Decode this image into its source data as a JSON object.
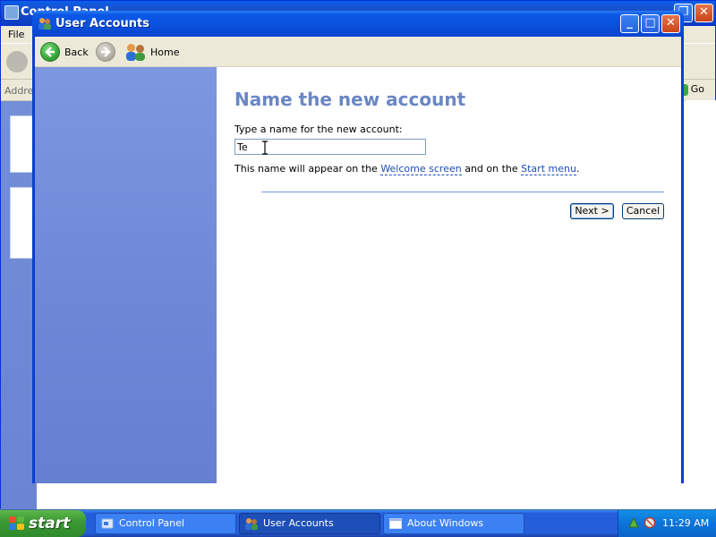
{
  "background_window": {
    "title": "Control Panel",
    "menu": "File",
    "address_label": "Address",
    "go_label": "Go"
  },
  "dialog": {
    "title": "User Accounts",
    "toolbar": {
      "back_label": "Back",
      "forward_label": "",
      "home_label": "Home"
    },
    "page_title": "Name the new account",
    "name_label": "Type a name for the new account:",
    "name_value": "Te",
    "hint_prefix": "This name will appear on the ",
    "hint_link1": "Welcome screen",
    "hint_middle": " and on the ",
    "hint_link2": "Start menu",
    "hint_suffix": ".",
    "next_label": "Next >",
    "cancel_label": "Cancel"
  },
  "taskbar": {
    "start_label": "start",
    "tasks": [
      {
        "label": "Control Panel",
        "icon": "control-panel-icon"
      },
      {
        "label": "User Accounts",
        "icon": "user-accounts-icon"
      },
      {
        "label": "About Windows",
        "icon": "window-icon"
      }
    ],
    "clock": "11:29 AM"
  },
  "colors": {
    "titlebar_blue": "#0a4fdc",
    "left_pane_blue": "#7d97e0",
    "page_title_blue": "#6a86c4",
    "link_blue": "#1c4eb7",
    "start_green": "#3c9a35",
    "taskbar_blue": "#245edb"
  }
}
